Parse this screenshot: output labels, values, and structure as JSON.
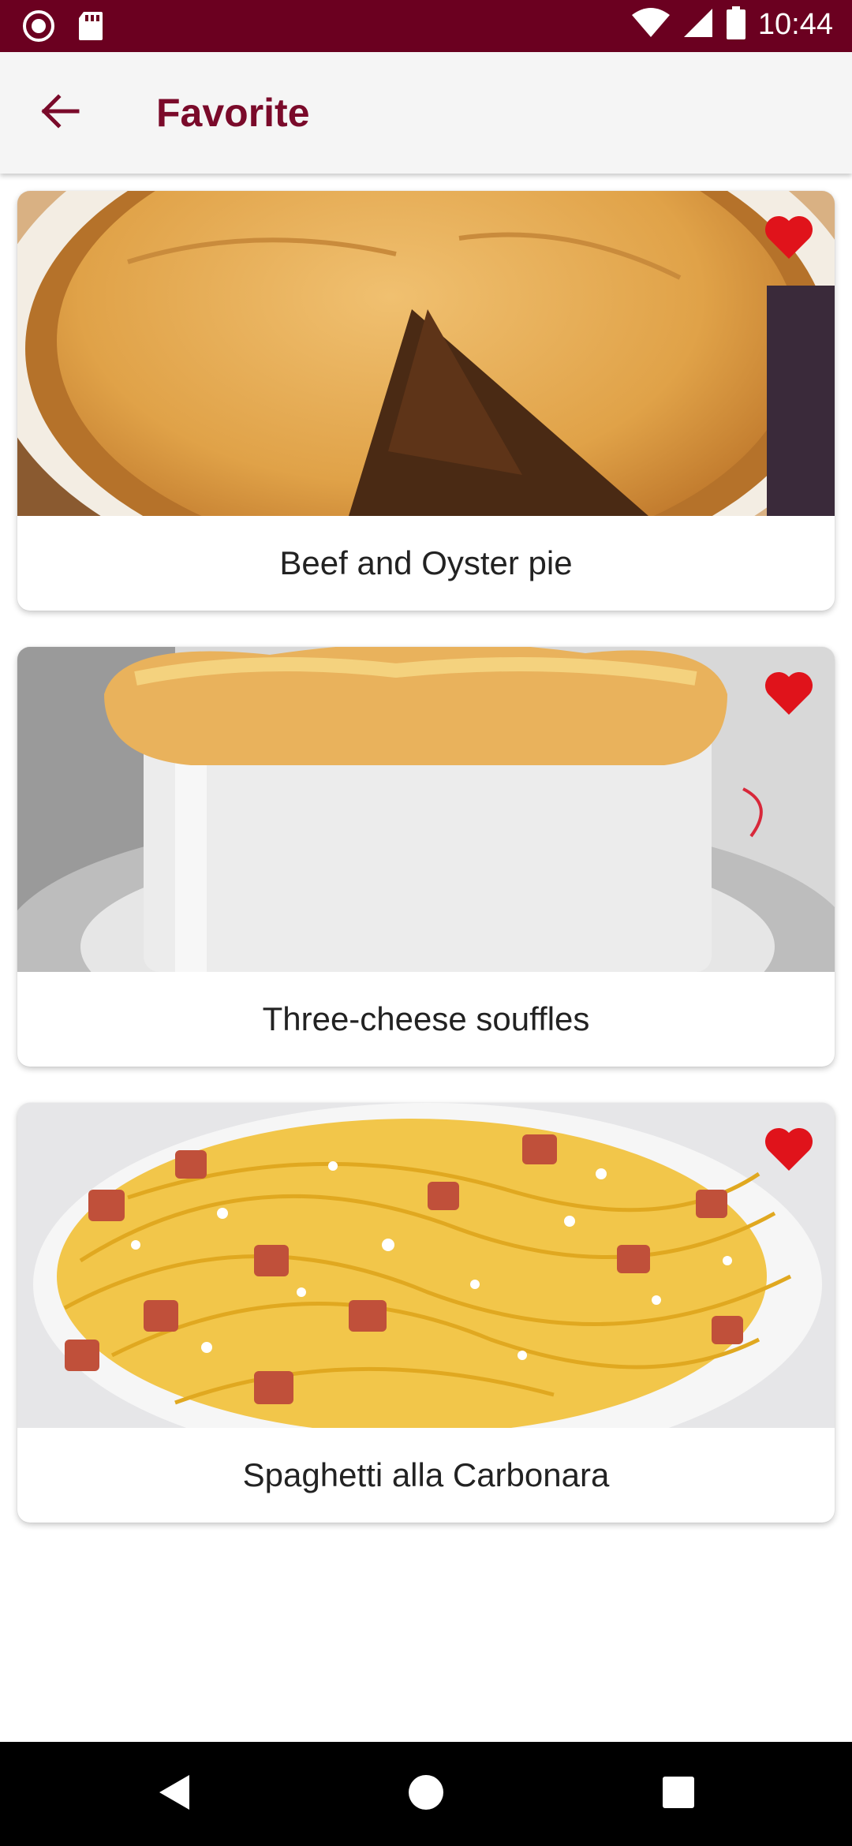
{
  "status_bar": {
    "time": "10:44",
    "icons": [
      "record-icon",
      "sd-card-icon",
      "wifi-icon",
      "signal-icon",
      "battery-icon"
    ]
  },
  "app_bar": {
    "title": "Favorite",
    "back_icon": "arrow-left-icon"
  },
  "favorites": [
    {
      "name": "Beef and Oyster pie",
      "favorite": true
    },
    {
      "name": "Three-cheese souffles",
      "favorite": true
    },
    {
      "name": "Spaghetti alla Carbonara",
      "favorite": true
    }
  ],
  "nav_bar": {
    "icons": [
      "back-triangle-icon",
      "home-circle-icon",
      "recents-square-icon"
    ]
  },
  "colors": {
    "primary_dark": "#6b0020",
    "accent": "#7a0a2a",
    "heart": "#e0131b"
  }
}
